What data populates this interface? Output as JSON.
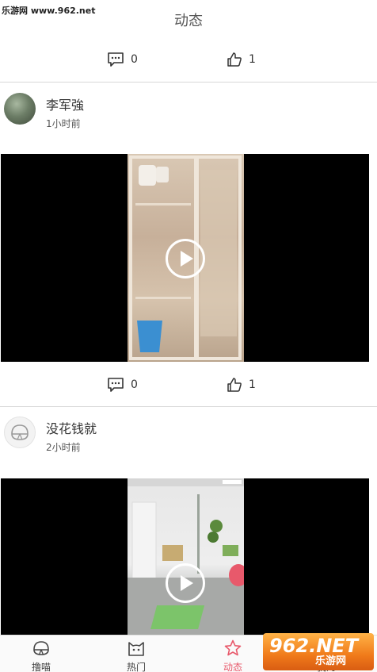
{
  "watermark_top": "乐游网 www.962.net",
  "header": {
    "title": "动态"
  },
  "top_actions": {
    "comments": "0",
    "likes": "1"
  },
  "posts": [
    {
      "username": "李军強",
      "time": "1小时前",
      "comments": "0",
      "likes": "1"
    },
    {
      "username": "没花钱就",
      "time": "2小时前"
    }
  ],
  "tabs": [
    {
      "label": "撸喵",
      "icon": "cat-bell-icon"
    },
    {
      "label": "热门",
      "icon": "cat-face-icon"
    },
    {
      "label": "动态",
      "icon": "star-icon"
    },
    {
      "label": "我的",
      "icon": "profile-icon"
    }
  ],
  "active_tab": "动态",
  "colors": {
    "accent": "#e8596b",
    "divider": "#d9d9d9",
    "video_bg": "#000000"
  },
  "watermark_br": {
    "big": "962.NET",
    "small": "乐游网"
  }
}
